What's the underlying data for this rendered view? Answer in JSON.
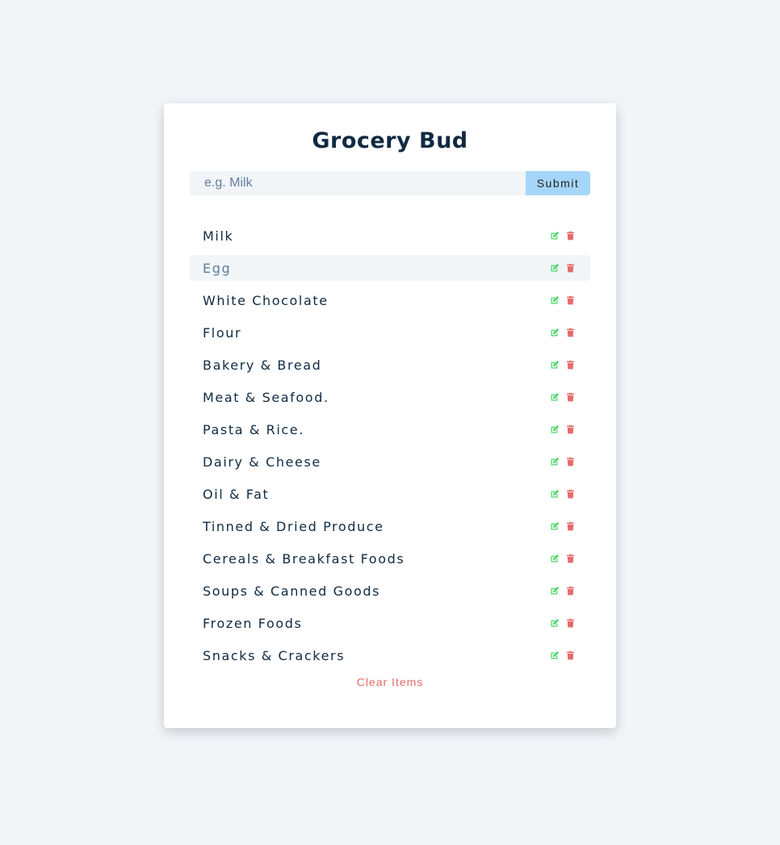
{
  "app": {
    "title": "Grocery Bud"
  },
  "form": {
    "placeholder": "e.g. Milk",
    "value": "",
    "submit_label": "Submit"
  },
  "items": [
    {
      "title": "Milk",
      "hovered": false
    },
    {
      "title": "Egg",
      "hovered": true
    },
    {
      "title": "White Chocolate",
      "hovered": false
    },
    {
      "title": "Flour",
      "hovered": false
    },
    {
      "title": "Bakery & Bread",
      "hovered": false
    },
    {
      "title": "Meat & Seafood.",
      "hovered": false
    },
    {
      "title": "Pasta & Rice.",
      "hovered": false
    },
    {
      "title": "Dairy & Cheese",
      "hovered": false
    },
    {
      "title": "Oil & Fat",
      "hovered": false
    },
    {
      "title": "Tinned & Dried Produce",
      "hovered": false
    },
    {
      "title": "Cereals & Breakfast Foods",
      "hovered": false
    },
    {
      "title": "Soups & Canned Goods",
      "hovered": false
    },
    {
      "title": "Frozen Foods",
      "hovered": false
    },
    {
      "title": "Snacks & Crackers",
      "hovered": false
    }
  ],
  "icons": {
    "edit": "edit-icon",
    "delete": "trash-icon"
  },
  "clear_label": "Clear Items",
  "colors": {
    "background": "#f1f5f8",
    "card": "#ffffff",
    "title": "#102a42",
    "submit": "#a5d5f8",
    "edit": "#4ad668",
    "delete": "#e66b6b",
    "clear": "#e66b6b"
  }
}
